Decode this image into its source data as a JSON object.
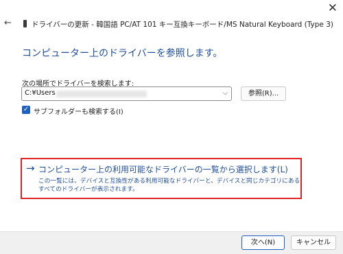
{
  "window": {
    "title": "ドライバーの更新 - 韓国語 PC/AT 101 キー互換キーボード/MS Natural Keyboard (Type 3)",
    "close_glyph": "✕",
    "back_glyph": "←"
  },
  "main": {
    "heading": "コンピューター上のドライバーを参照します。",
    "search_label": "次の場所でドライバーを検索します:",
    "path_value": "C:¥Users",
    "browse_label": "参照(R)...",
    "include_subfolders_label": "サブフォルダーも検索する(I)",
    "include_subfolders_checked": true
  },
  "pick_option": {
    "title": "コンピューター上の利用可能なドライバーの一覧から選択します(L)",
    "description": "この一覧には、デバイスと互換性がある利用可能なドライバーと、デバイスと同じカテゴリにあるすべてのドライバーが表示されます。"
  },
  "footer": {
    "next_label": "次へ(N)",
    "cancel_label": "キャンセル"
  },
  "colors": {
    "accent": "#1f4e99",
    "highlight_border": "#e02020",
    "checkbox": "#1f5fbf"
  }
}
